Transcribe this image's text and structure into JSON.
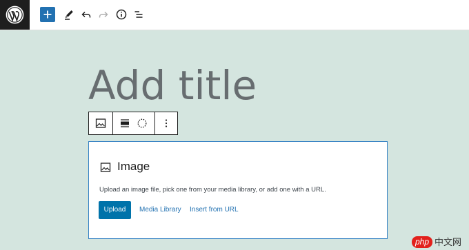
{
  "topbar": {
    "logo_icon": "wordpress-logo-icon",
    "tools": [
      {
        "name": "add-block-icon"
      },
      {
        "name": "pencil-icon"
      },
      {
        "name": "undo-icon"
      },
      {
        "name": "redo-icon"
      },
      {
        "name": "info-icon"
      },
      {
        "name": "list-view-icon"
      }
    ],
    "accent": "#2271b1"
  },
  "editor": {
    "title_placeholder": "Add title"
  },
  "block_toolbar": {
    "items": [
      "image-icon",
      "align-icon",
      "dotted-circle-icon",
      "more-options-icon"
    ]
  },
  "image_block": {
    "icon": "image-icon",
    "title": "Image",
    "description": "Upload an image file, pick one from your media library, or add one with a URL.",
    "upload_label": "Upload",
    "media_library_label": "Media Library",
    "insert_url_label": "Insert from URL"
  },
  "watermark": {
    "php_label": "php",
    "site_label": "中文网"
  }
}
